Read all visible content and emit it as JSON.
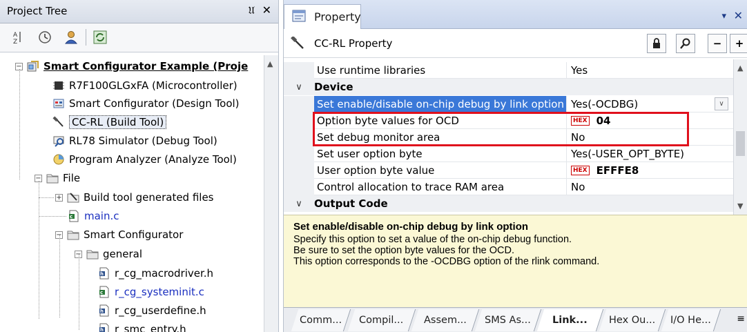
{
  "left_pane": {
    "title": "Project Tree",
    "pin_glyph": "ᴘ",
    "close_glyph": "✕",
    "toolbar_icons": [
      "sort-icon",
      "clock-icon",
      "user-icon",
      "refresh-icon"
    ],
    "tree": [
      {
        "label": "Smart Configurator Example (Proje",
        "icon": "project-icon",
        "style": "bold",
        "expander": "−"
      },
      {
        "label": "R7F100GLGxFA (Microcontroller)",
        "icon": "chip-icon"
      },
      {
        "label": "Smart Configurator (Design Tool)",
        "icon": "design-tool-icon"
      },
      {
        "label": "CC-RL (Build Tool)",
        "icon": "build-tool-icon",
        "style": "selected"
      },
      {
        "label": "RL78 Simulator (Debug Tool)",
        "icon": "debug-tool-icon"
      },
      {
        "label": "Program Analyzer (Analyze Tool)",
        "icon": "analyzer-icon"
      },
      {
        "label": "File",
        "icon": "folder-icon",
        "expander": "−"
      },
      {
        "label": "Build tool generated files",
        "icon": "build-files-icon",
        "expander": "+"
      },
      {
        "label": "main.c",
        "icon": "c-file-icon",
        "style": "link"
      },
      {
        "label": "Smart Configurator",
        "icon": "folder-icon",
        "expander": "−"
      },
      {
        "label": "general",
        "icon": "folder-icon",
        "expander": "−"
      },
      {
        "label": "r_cg_macrodriver.h",
        "icon": "h-file-icon"
      },
      {
        "label": "r_cg_systeminit.c",
        "icon": "c-file-icon",
        "style": "link"
      },
      {
        "label": "r_cg_userdefine.h",
        "icon": "h-file-icon"
      },
      {
        "label": "r_smc_entry.h",
        "icon": "h-file-icon"
      }
    ]
  },
  "right_pane": {
    "title": "Property",
    "dropdown_glyph": "▾",
    "close_glyph": "✕",
    "sub_title": "CC-RL Property",
    "sub_buttons": [
      "🔒",
      "🔍",
      "−",
      "+"
    ],
    "rows": [
      {
        "type": "prop",
        "name": "Use runtime libraries",
        "value": "Yes"
      },
      {
        "type": "category",
        "name": "Device"
      },
      {
        "type": "prop",
        "name": "Set enable/disable on-chip debug by link option",
        "value": "Yes(-OCDBG)",
        "selected": true,
        "combo": true
      },
      {
        "type": "prop",
        "name": "Option byte values for OCD",
        "value": "04",
        "hex": true
      },
      {
        "type": "prop",
        "name": "Set debug monitor area",
        "value": "No"
      },
      {
        "type": "prop",
        "name": "Set user option byte",
        "value": "Yes(-USER_OPT_BYTE)"
      },
      {
        "type": "prop",
        "name": "User option byte value",
        "value": "EFFFE8",
        "hex": true
      },
      {
        "type": "prop",
        "name": "Control allocation to trace RAM area",
        "value": "No"
      },
      {
        "type": "category",
        "name": "Output Code"
      }
    ],
    "hex_badge": "HEX",
    "description": {
      "title": "Set enable/disable on-chip debug by link option",
      "lines": [
        "Specify this option to set a value of the on-chip debug function.",
        "Be sure to set the option byte values for the OCD.",
        "This option corresponds to the -OCDBG option of the rlink command."
      ]
    },
    "tabs": [
      "Comm...",
      "Compil...",
      "Assem...",
      "SMS As...",
      "Link...",
      "Hex Ou...",
      "I/O He..."
    ],
    "active_tab": 4,
    "tabs_menu_glyph": "▾",
    "colors": {
      "selection": "#3a78d8",
      "highlight_box": "#e0101c",
      "description_bg": "#fbf8d5"
    }
  }
}
